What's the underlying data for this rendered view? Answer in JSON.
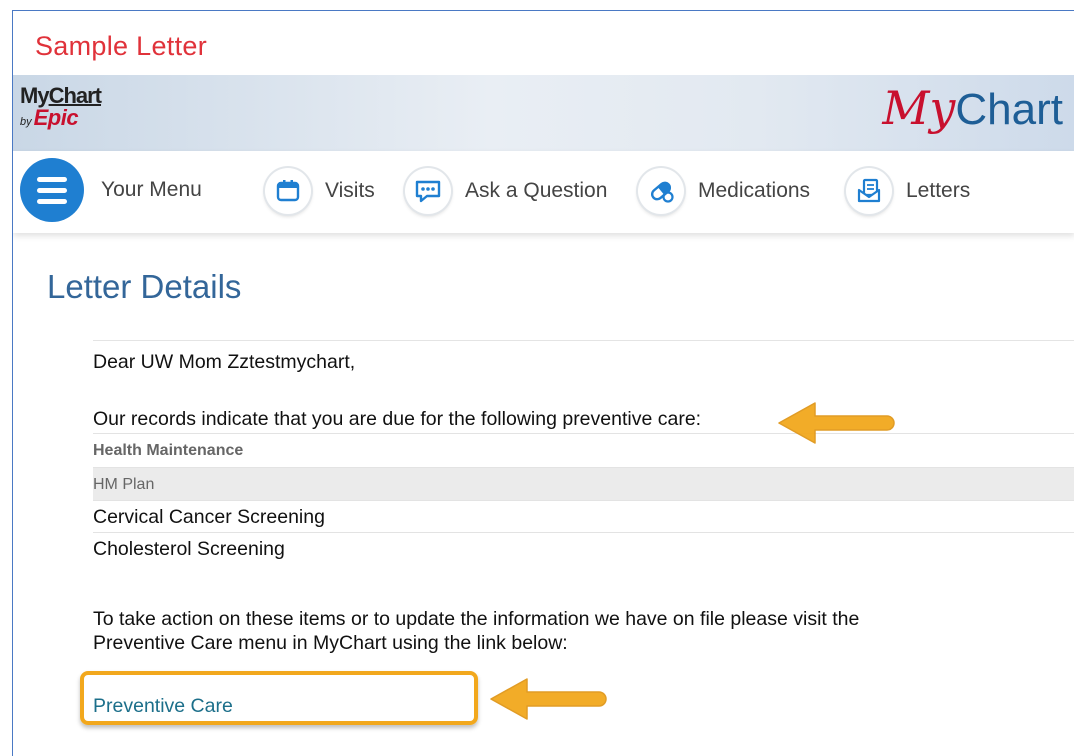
{
  "caption": "Sample Letter",
  "header": {
    "logo_left": {
      "line1_prefix": "My",
      "line1_suffix": "Chart",
      "by": "by",
      "brand": "Epic"
    },
    "logo_right": {
      "script": "My",
      "word": "Chart"
    }
  },
  "nav": {
    "menu_label": "Your Menu",
    "items": [
      {
        "label": "Visits",
        "icon": "calendar-icon"
      },
      {
        "label": "Ask a Question",
        "icon": "message-icon"
      },
      {
        "label": "Medications",
        "icon": "pill-icon"
      },
      {
        "label": "Letters",
        "icon": "letter-icon"
      }
    ]
  },
  "letter": {
    "title": "Letter Details",
    "greeting": "Dear UW Mom Zztestmychart,",
    "intro": "Our records indicate that you are due for the following preventive care:",
    "section_header": "Health Maintenance",
    "plan_header": "HM Plan",
    "items": [
      "Cervical Cancer Screening",
      "Cholesterol Screening"
    ],
    "action_line1": "To take action on these items or to update the information we have on file please visit the",
    "action_line2": "Preventive Care menu in MyChart using the link below:",
    "link_label": "Preventive Care"
  },
  "colors": {
    "caption": "#e0323a",
    "title": "#336699",
    "menu_button": "#1f7fd1",
    "highlight": "#f2a81d",
    "link": "#1c6f8a"
  }
}
